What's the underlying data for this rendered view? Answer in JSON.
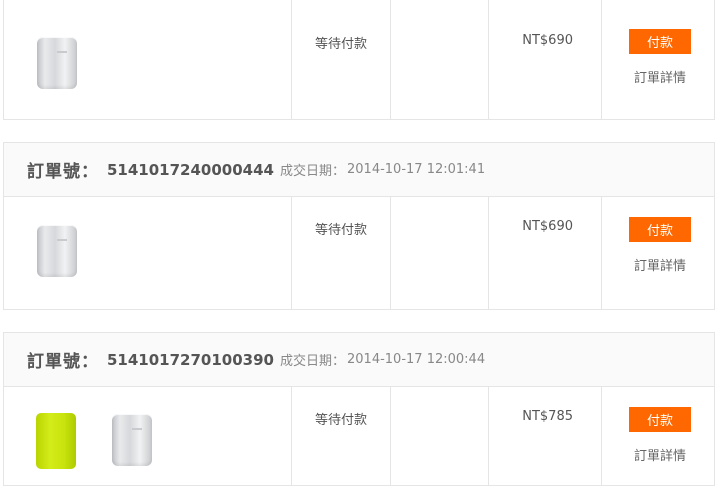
{
  "orders": [
    {
      "status": "等待付款",
      "price": "NT$690",
      "pay_label": "付款",
      "detail_label": "訂單詳情",
      "products": [
        "silver-power-bank"
      ]
    },
    {
      "label": "訂單號：",
      "number": "5141017240000444",
      "date_label": "成交日期：",
      "date": "2014-10-17 12:01:41",
      "status": "等待付款",
      "price": "NT$690",
      "pay_label": "付款",
      "detail_label": "訂單詳情",
      "products": [
        "silver-power-bank"
      ]
    },
    {
      "label": "訂單號：",
      "number": "5141017270100390",
      "date_label": "成交日期：",
      "date": "2014-10-17 12:00:44",
      "status": "等待付款",
      "price": "NT$785",
      "pay_label": "付款",
      "detail_label": "訂單詳情",
      "products": [
        "green-power-bank",
        "silver-power-bank"
      ]
    }
  ],
  "colors": {
    "accent": "#ff6700",
    "border": "#e5e5e5",
    "header_bg": "#fafafa"
  }
}
